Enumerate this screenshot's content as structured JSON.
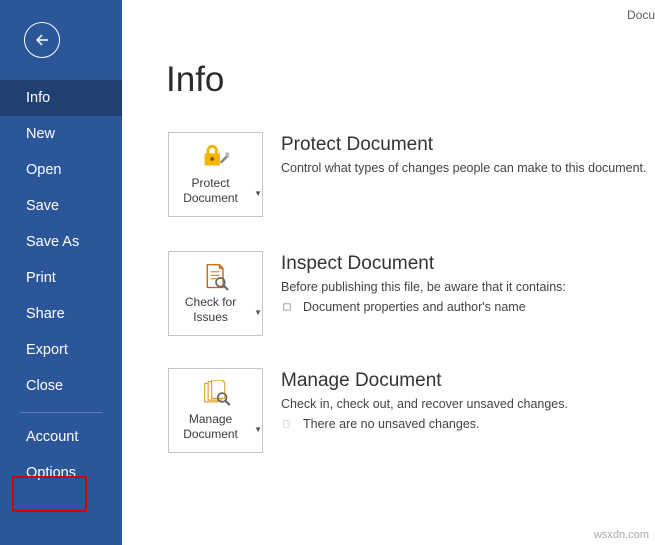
{
  "header": {
    "doc_label": "Docu"
  },
  "sidebar": {
    "items": [
      {
        "label": "Info",
        "active": true
      },
      {
        "label": "New",
        "active": false
      },
      {
        "label": "Open",
        "active": false
      },
      {
        "label": "Save",
        "active": false
      },
      {
        "label": "Save As",
        "active": false
      },
      {
        "label": "Print",
        "active": false
      },
      {
        "label": "Share",
        "active": false
      },
      {
        "label": "Export",
        "active": false
      },
      {
        "label": "Close",
        "active": false
      }
    ],
    "bottom_items": [
      {
        "label": "Account"
      },
      {
        "label": "Options"
      }
    ]
  },
  "page": {
    "title": "Info"
  },
  "sections": {
    "protect": {
      "card_label": "Protect Document",
      "title": "Protect Document",
      "desc": "Control what types of changes people can make to this document."
    },
    "inspect": {
      "card_label": "Check for Issues",
      "title": "Inspect Document",
      "desc": "Before publishing this file, be aware that it contains:",
      "bullet": "Document properties and author's name"
    },
    "manage": {
      "card_label": "Manage Document",
      "title": "Manage Document",
      "desc": "Check in, check out, and recover unsaved changes.",
      "bullet": "There are no unsaved changes."
    }
  },
  "watermark": "wsxdn.com"
}
